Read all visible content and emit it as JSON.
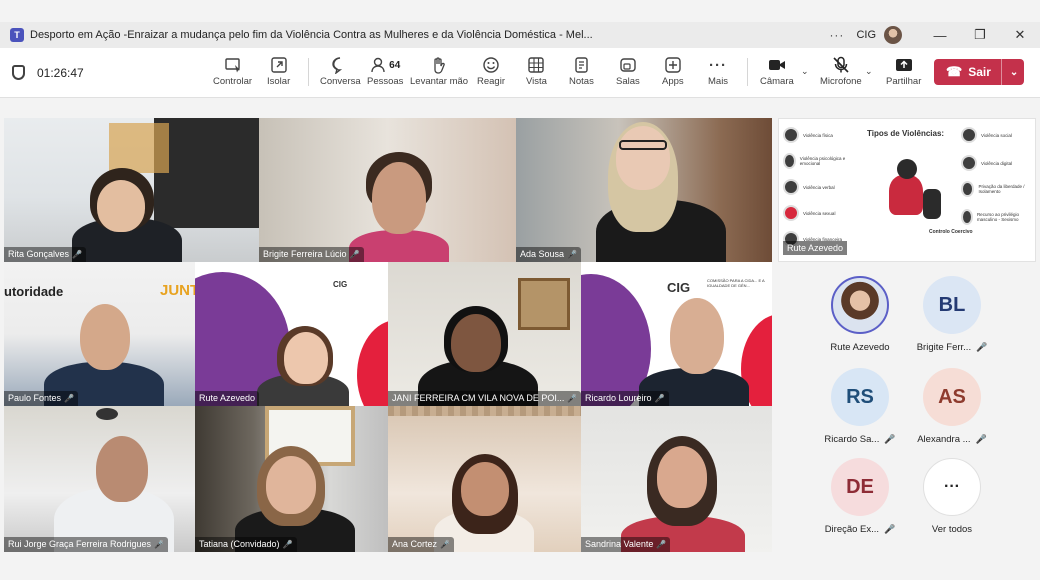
{
  "window": {
    "title": "Desporto em Ação -Enraizar a mudança pelo fim da Violência Contra as Mulheres e da Violência Doméstica - Mel...",
    "more": "···",
    "org": "CIG",
    "minimize": "—",
    "restore": "❐",
    "close": "✕"
  },
  "toolbar": {
    "timer": "01:26:47",
    "buttons": [
      {
        "label": "Controlar",
        "icon": "control-icon"
      },
      {
        "label": "Isolar",
        "icon": "popout-icon"
      },
      {
        "label": "Conversa",
        "icon": "chat-icon"
      },
      {
        "label": "Pessoas",
        "icon": "people-icon",
        "count": "64"
      },
      {
        "label": "Levantar mão",
        "icon": "raise-hand-icon"
      },
      {
        "label": "Reagir",
        "icon": "react-icon"
      },
      {
        "label": "Vista",
        "icon": "view-icon"
      },
      {
        "label": "Notas",
        "icon": "notes-icon"
      },
      {
        "label": "Salas",
        "icon": "rooms-icon"
      },
      {
        "label": "Apps",
        "icon": "apps-icon"
      },
      {
        "label": "Mais",
        "icon": "more-icon"
      },
      {
        "label": "Câmara",
        "icon": "camera-icon"
      },
      {
        "label": "Microfone",
        "icon": "microphone-off-icon"
      },
      {
        "label": "Partilhar",
        "icon": "share-icon"
      }
    ],
    "leave_label": "Sair",
    "colors": {
      "leave": "#c4314b"
    }
  },
  "videos": [
    {
      "name": "Rita Gonçalves"
    },
    {
      "name": "Brigite Ferreira Lúcio"
    },
    {
      "name": "Ada Sousa"
    },
    {
      "name": "Paulo Fontes",
      "banner_left": "utoridade",
      "banner_right": "JUNT"
    },
    {
      "name": "Rute  Azevedo",
      "logo": "CIG"
    },
    {
      "name": "JANI FERREIRA CM VILA NOVA DE POI..."
    },
    {
      "name": "Ricardo Loureiro",
      "logo": "CIG",
      "logo_sub": "COMISSÃO PARA A CIDA... E A IGUALDADE DE GÉN..."
    },
    {
      "name": "Rui Jorge Graça Ferreira Rodrigues"
    },
    {
      "name": "Tatiana (Convidado)"
    },
    {
      "name": "Ana Cortez"
    },
    {
      "name": "Sandrina Valente"
    }
  ],
  "shared_slide": {
    "presenter": "Rute Azevedo",
    "title": "Tipos de Violências:",
    "left_items": [
      "Violência física",
      "Violência psicológica e emocional",
      "Violência verbal",
      "Violência sexual",
      "Violência financeira"
    ],
    "right_items": [
      "Violência social",
      "Violência digital",
      "Privação da liberdade / Isolamento",
      "Recurso ao privilégio masculino - Sexismo"
    ],
    "footer_heading": "Controlo Coercivo"
  },
  "participants": [
    {
      "name": "Rute Azevedo",
      "initials": "",
      "muted": false,
      "bg": "#dbe3ef",
      "fg": "#1f3a5f"
    },
    {
      "name": "Brigite Ferr...",
      "initials": "BL",
      "muted": true,
      "bg": "#dbe6f4",
      "fg": "#243a73"
    },
    {
      "name": "Ricardo Sa...",
      "initials": "RS",
      "muted": true,
      "bg": "#d8e6f5",
      "fg": "#1f4e79"
    },
    {
      "name": "Alexandra ...",
      "initials": "AS",
      "muted": true,
      "bg": "#f6ddd6",
      "fg": "#8e3b2e"
    },
    {
      "name": "Direção Ex...",
      "initials": "DE",
      "muted": true,
      "bg": "#f6dcdd",
      "fg": "#8e2c36"
    },
    {
      "name": "Ver todos",
      "initials": "···",
      "muted": false,
      "bg": "#ffffff",
      "fg": "#242424"
    }
  ],
  "icons": {
    "mic_muted": "🎤"
  }
}
